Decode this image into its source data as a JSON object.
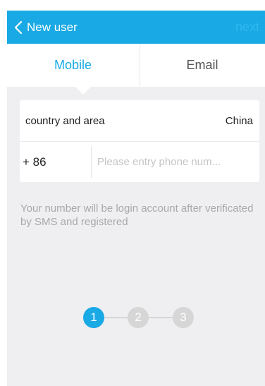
{
  "header": {
    "back_label": "New user",
    "next_label": "next",
    "back_icon": "chevron-left-icon"
  },
  "tabs": [
    {
      "label": "Mobile",
      "active": true
    },
    {
      "label": "Email",
      "active": false
    }
  ],
  "form": {
    "country_label": "country and area",
    "country_value": "China",
    "country_code": "+ 86",
    "phone_value": "",
    "phone_placeholder": "Please entry phone num..."
  },
  "hint": "Your number will be login account after verificated by SMS and registered",
  "steps": {
    "items": [
      "1",
      "2",
      "3"
    ],
    "current": 1
  },
  "colors": {
    "accent": "#19a9e4",
    "background": "#efeff1",
    "inactive_step": "#d6d6d6",
    "hint_text": "#a9a9a9"
  }
}
